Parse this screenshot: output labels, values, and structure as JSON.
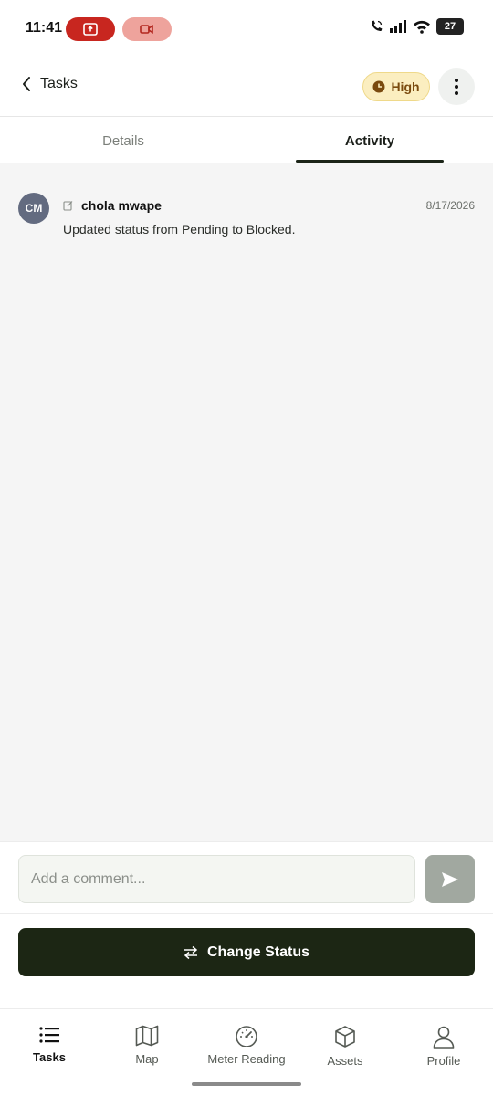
{
  "status_bar": {
    "time": "11:41",
    "battery": "27"
  },
  "header": {
    "back_label": "Tasks",
    "priority": "High"
  },
  "tabs": [
    {
      "label": "Details",
      "active": false
    },
    {
      "label": "Activity",
      "active": true
    }
  ],
  "activity": [
    {
      "initials": "CM",
      "author": "chola mwape",
      "date": "8/17/2026",
      "text": "Updated status from Pending to Blocked."
    }
  ],
  "comment": {
    "placeholder": "Add a comment...",
    "value": ""
  },
  "action": {
    "change_status_label": "Change Status"
  },
  "nav": [
    {
      "label": "Tasks",
      "icon": "list-icon",
      "active": true
    },
    {
      "label": "Map",
      "icon": "map-icon",
      "active": false
    },
    {
      "label": "Meter Reading",
      "icon": "gauge-icon",
      "active": false
    },
    {
      "label": "Assets",
      "icon": "box-icon",
      "active": false
    },
    {
      "label": "Profile",
      "icon": "user-icon",
      "active": false
    }
  ],
  "colors": {
    "primary_dark": "#1c2614",
    "priority_bg": "#fbeec0",
    "priority_text": "#7a4a0e",
    "recording": "#c8261f",
    "avatar": "#636b80"
  }
}
